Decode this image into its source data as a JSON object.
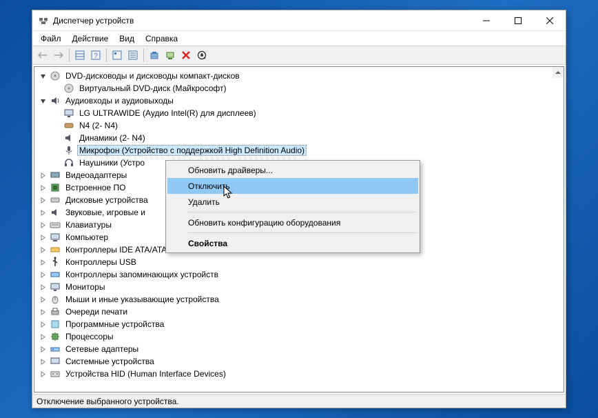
{
  "window": {
    "title": "Диспетчер устройств"
  },
  "menubar": {
    "file": "Файл",
    "action": "Действие",
    "view": "Вид",
    "help": "Справка"
  },
  "tree": {
    "cat_dvd": "DVD-дисководы и дисководы компакт-дисков",
    "dvd_virtual": "Виртуальный DVD-диск (Майкрософт)",
    "cat_audio": "Аудиовходы и аудиовыходы",
    "lg": "LG ULTRAWIDE (Аудио Intel(R) для дисплеев)",
    "n4": "N4 (2- N4)",
    "speakers": "Динамики (2- N4)",
    "mic": "Микрофон (Устройство с поддержкой High Definition Audio)",
    "headphones": "Наушники (Устро",
    "cat_video": "Видеоадаптеры",
    "cat_firmware": "Встроенное ПО",
    "cat_disk": "Дисковые устройства",
    "cat_sound": "Звуковые, игровые и",
    "cat_keyboard": "Клавиатуры",
    "cat_computer": "Компьютер",
    "cat_ide": "Контроллеры IDE ATA/ATAPI",
    "cat_usb": "Контроллеры USB",
    "cat_storage": "Контроллеры запоминающих устройств",
    "cat_monitor": "Мониторы",
    "cat_mouse": "Мыши и иные указывающие устройства",
    "cat_print": "Очереди печати",
    "cat_software": "Программные устройства",
    "cat_cpu": "Процессоры",
    "cat_network": "Сетевые адаптеры",
    "cat_system": "Системные устройства",
    "cat_hid": "Устройства HID (Human Interface Devices)"
  },
  "context_menu": {
    "update_drivers": "Обновить драйверы...",
    "disable": "Отключить",
    "delete": "Удалить",
    "scan_hardware": "Обновить конфигурацию оборудования",
    "properties": "Свойства"
  },
  "statusbar": {
    "text": "Отключение выбранного устройства."
  }
}
